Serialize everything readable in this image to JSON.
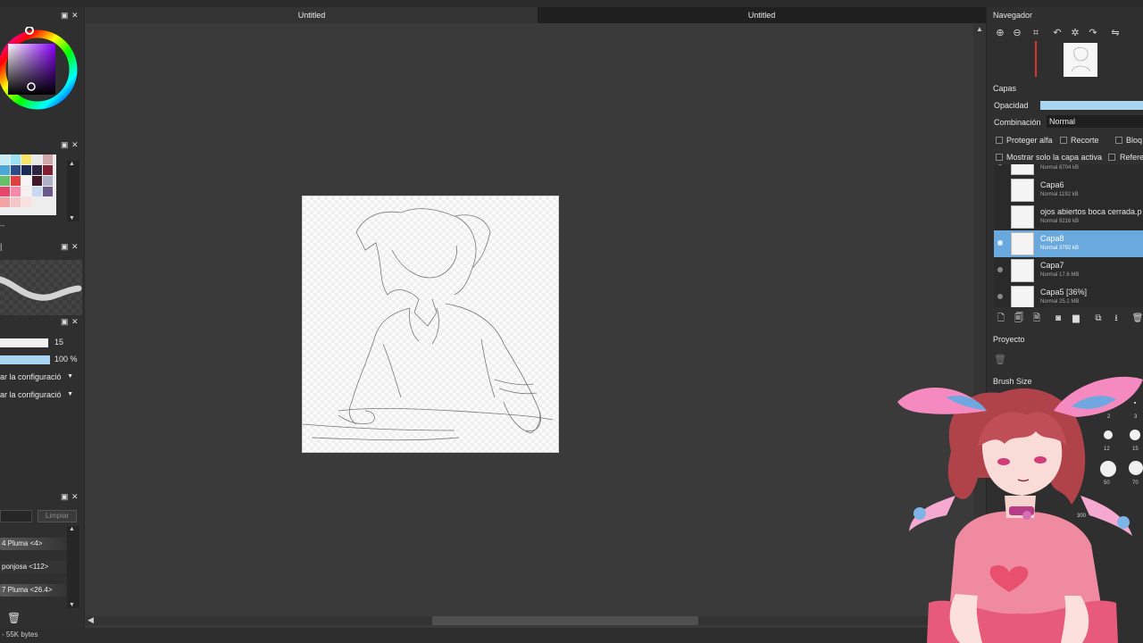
{
  "tabs": [
    {
      "label": "Untitled",
      "active": false
    },
    {
      "label": "Untitled",
      "active": true
    }
  ],
  "status": {
    "memory": "- 55K bytes"
  },
  "left": {
    "size_value": "15",
    "opacity_value": "100 %",
    "setting_1": "ar la configuració",
    "setting_2": "ar la configuració",
    "clear_button": "Limpiar",
    "minus_sign": "--",
    "tools": [
      {
        "label": "4 Pluma <4>"
      },
      {
        "label": "ponjosa <112>"
      },
      {
        "label": "7 Pluma <26.4>"
      }
    ]
  },
  "navigator": {
    "title": "Navegador"
  },
  "layers_panel": {
    "title": "Capas",
    "opacity_label": "Opacidad",
    "blend_label": "Combinación",
    "blend_value": "Normal",
    "protect_alpha": "Proteger alfa",
    "clipping": "Recorte",
    "lock": "Bloq",
    "show_active_only": "Mostrar solo la capa activa",
    "reference": "Referen",
    "layers": [
      {
        "name": "",
        "meta": "Normal 8704 kB",
        "selected": false
      },
      {
        "name": "Capa6",
        "meta": "Normal 1192 kB",
        "selected": false
      },
      {
        "name": "ojos abiertos boca cerrada.p",
        "meta": "Normal 9216 kB",
        "selected": false
      },
      {
        "name": "Capa8",
        "meta": "Normal 3792 kB",
        "selected": true
      },
      {
        "name": "Capa7",
        "meta": "Normal 17.6 MB",
        "selected": false
      },
      {
        "name": "Capa5 [36%]",
        "meta": "Normal 25.1 MB",
        "selected": false
      }
    ]
  },
  "project": {
    "title": "Proyecto"
  },
  "brush_size": {
    "title": "Brush Size",
    "labels": [
      "1",
      "2",
      "3",
      "12",
      "15",
      "50",
      "70",
      "300",
      "400"
    ]
  },
  "colors": {
    "accent": "#6aa9dd",
    "opacity_bar": "#a9d4f2",
    "panel": "#2f2f2f",
    "workspace": "#3a3a3a"
  }
}
